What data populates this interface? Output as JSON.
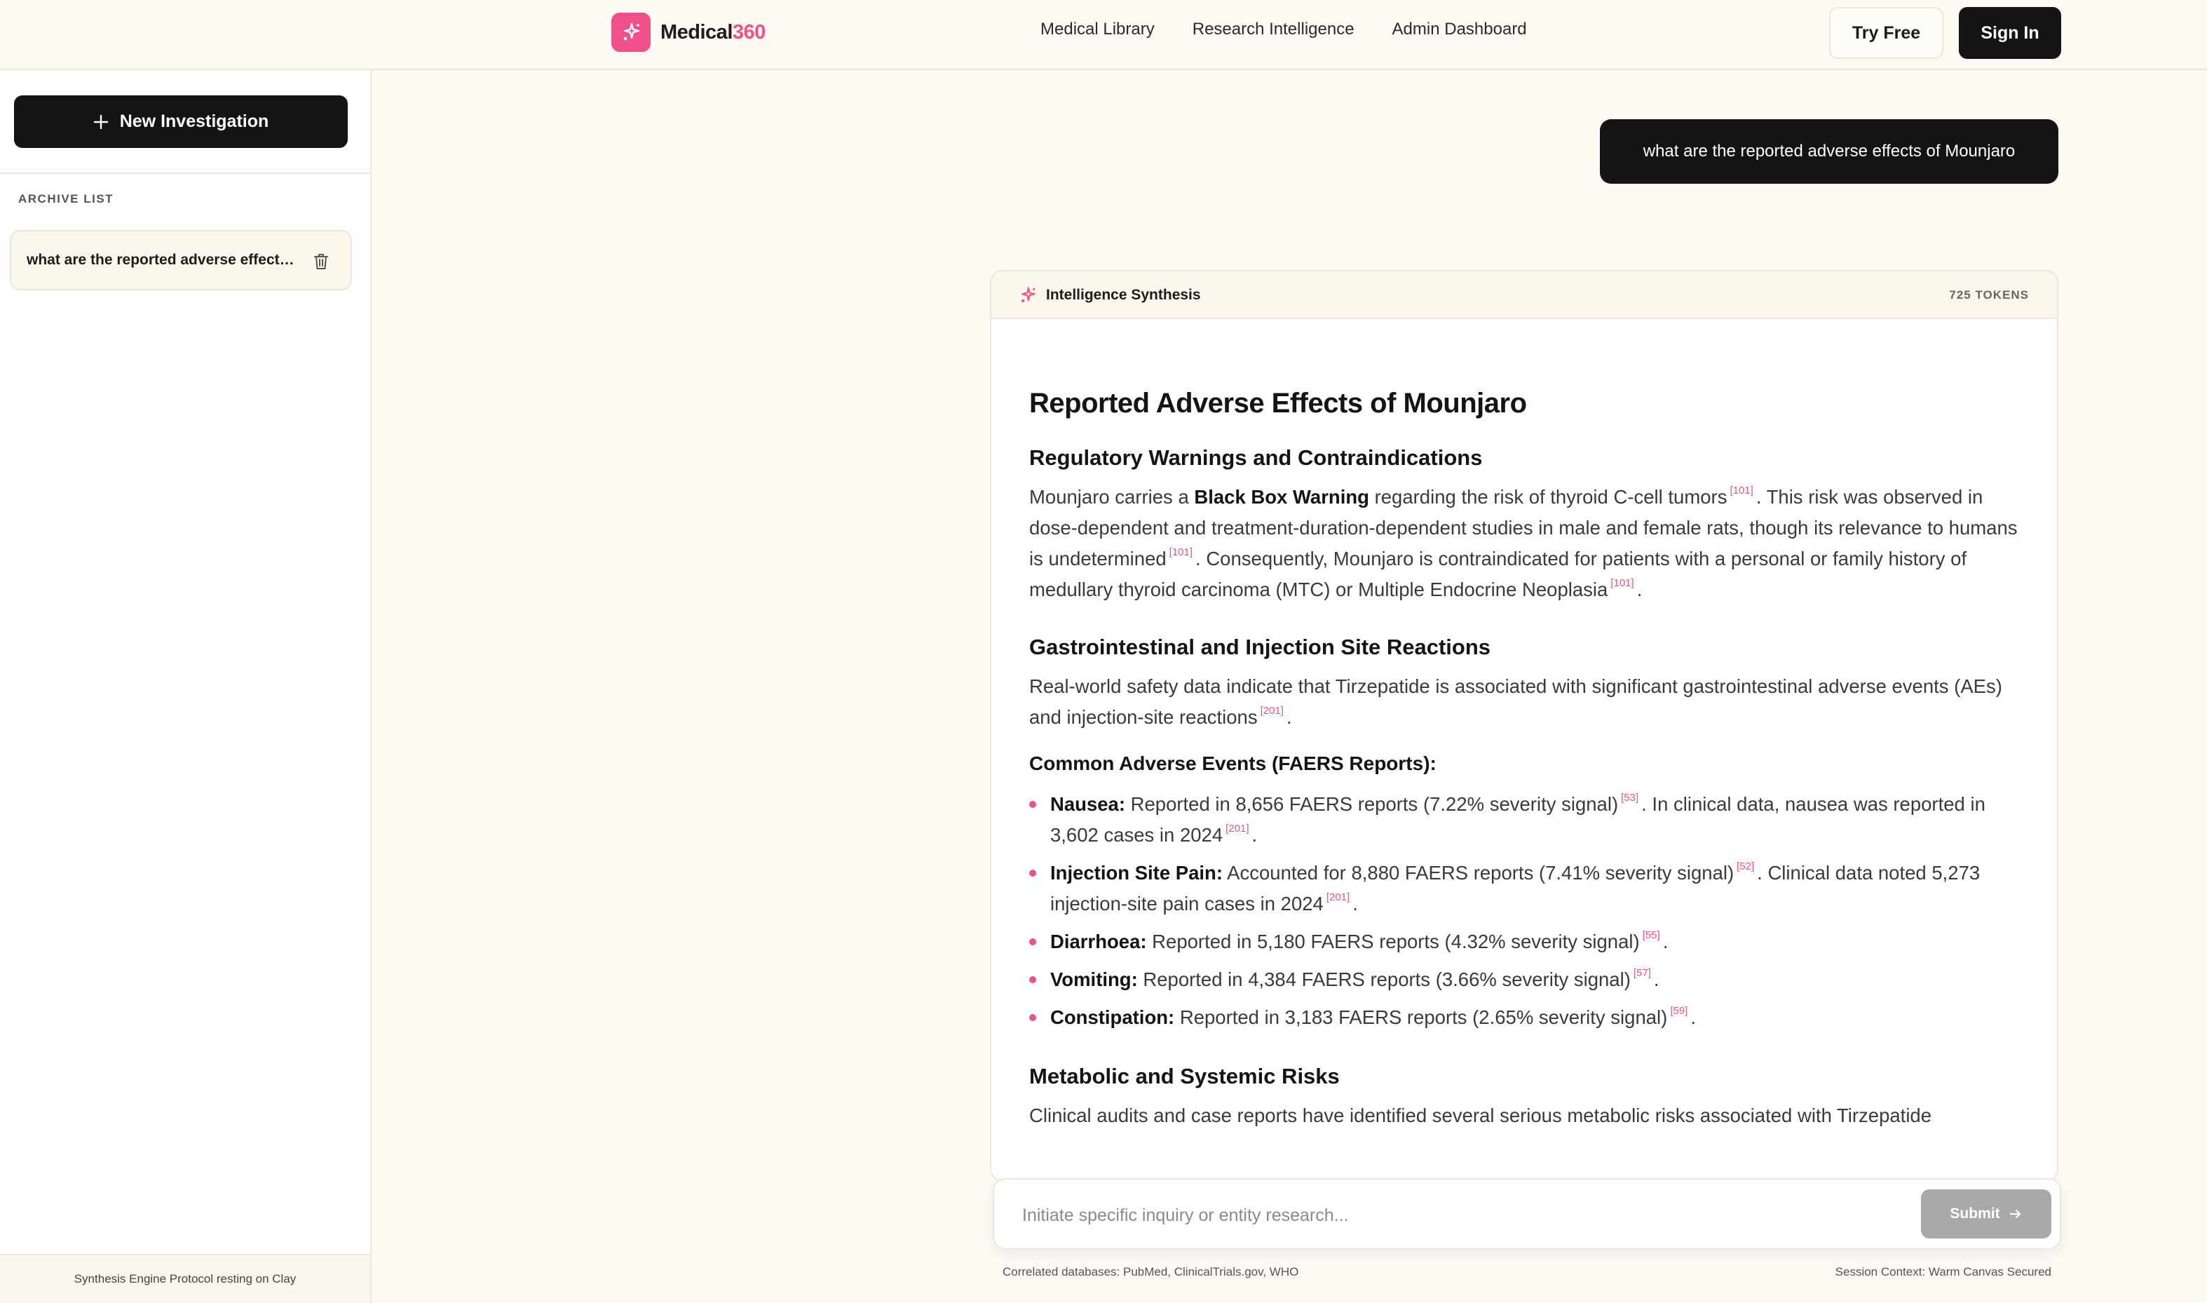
{
  "header": {
    "brand_name": "Medical",
    "brand_accent": "360",
    "nav": [
      "Medical Library",
      "Research Intelligence",
      "Admin Dashboard"
    ],
    "try_free": "Try Free",
    "sign_in": "Sign In"
  },
  "sidebar": {
    "new_investigation": "New Investigation",
    "archive_label": "ARCHIVE LIST",
    "archive_items": [
      "what are the reported adverse effects of Mounjaro"
    ],
    "footer": "Synthesis Engine Protocol resting on Clay"
  },
  "chat": {
    "user_message": "what are the reported adverse effects of Mounjaro",
    "card_title": "Intelligence Synthesis",
    "tokens": "725 TOKENS"
  },
  "answer": {
    "title": "Reported Adverse Effects of Mounjaro",
    "s1_heading": "Regulatory Warnings and Contraindications",
    "s1_p_a": "Mounjaro carries a ",
    "s1_p_bold": "Black Box Warning",
    "s1_p_b": " regarding the risk of thyroid C-cell tumors",
    "s1_p_c": ". This risk was observed in dose-dependent and treatment-duration-dependent studies in male and female rats, though its relevance to humans is undetermined",
    "s1_p_d": ". Consequently, Mounjaro is contraindicated for patients with a personal or family history of medullary thyroid carcinoma (MTC) or Multiple Endocrine Neoplasia",
    "s1_p_e": ".",
    "s2_heading": "Gastrointestinal and Injection Site Reactions",
    "s2_p_a": "Real-world safety data indicate that Tirzepatide is associated with significant gastrointestinal adverse events (AEs) and injection-site reactions",
    "s2_p_b": ".",
    "s3_heading": "Common Adverse Events (FAERS Reports):",
    "ae": [
      {
        "name": "Nausea:",
        "text": " Reported in 8,656 FAERS reports (7.22% severity signal)",
        "c1": "[53]",
        "text2": ". In clinical data, nausea was reported in 3,602 cases in 2024",
        "c2": "[201]",
        "end": "."
      },
      {
        "name": "Injection Site Pain:",
        "text": " Accounted for 8,880 FAERS reports (7.41% severity signal)",
        "c1": "[52]",
        "text2": ". Clinical data noted 5,273 injection-site pain cases in 2024",
        "c2": "[201]",
        "end": "."
      },
      {
        "name": "Diarrhoea:",
        "text": " Reported in 5,180 FAERS reports (4.32% severity signal)",
        "c1": "[55]",
        "end": "."
      },
      {
        "name": "Vomiting:",
        "text": " Reported in 4,384 FAERS reports (3.66% severity signal)",
        "c1": "[57]",
        "end": "."
      },
      {
        "name": "Constipation:",
        "text": " Reported in 3,183 FAERS reports (2.65% severity signal)",
        "c1": "[59]",
        "end": "."
      }
    ],
    "cite_101": "[101]",
    "cite_201": "[201]",
    "s4_heading": "Metabolic and Systemic Risks",
    "s4_p": "Clinical audits and case reports have identified several serious metabolic risks associated with Tirzepatide"
  },
  "input": {
    "placeholder": "Initiate specific inquiry or entity research...",
    "submit": "Submit"
  },
  "footer": {
    "left": "Correlated databases: PubMed, ClinicalTrials.gov, WHO",
    "right": "Session Context: Warm Canvas Secured"
  },
  "colors": {
    "accent": "#f0508a",
    "dark": "#141414",
    "canvas": "#fcfaf3"
  }
}
